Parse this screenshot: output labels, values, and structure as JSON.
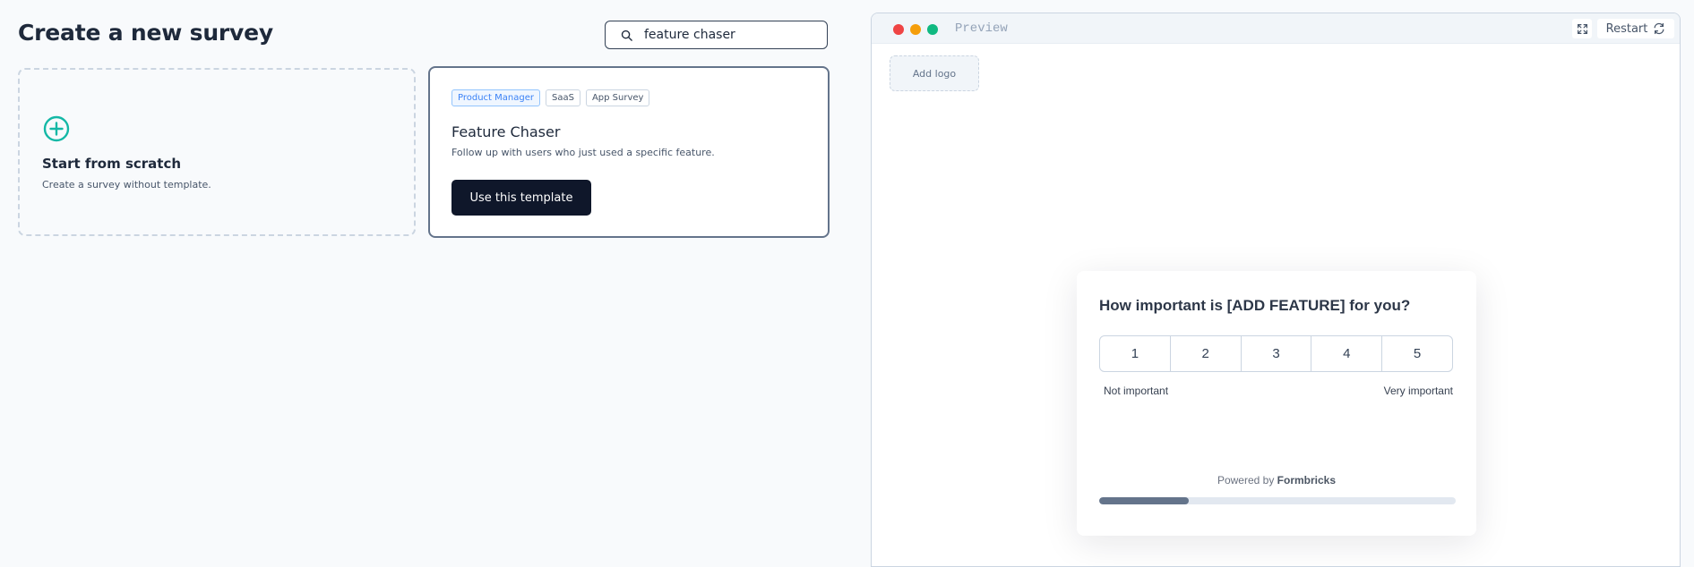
{
  "header": {
    "title": "Create a new survey"
  },
  "search": {
    "value": "feature chaser",
    "icon": "search-icon"
  },
  "scratch_card": {
    "title": "Start from scratch",
    "description": "Create a survey without template.",
    "icon": "plus-circle-icon",
    "icon_color": "#14b8a6"
  },
  "template_card": {
    "tags": [
      "Product Manager",
      "SaaS",
      "App Survey"
    ],
    "name": "Feature Chaser",
    "description": "Follow up with users who just used a specific feature.",
    "button_label": "Use this template"
  },
  "preview": {
    "label": "Preview",
    "restart_label": "Restart",
    "add_logo_label": "Add logo",
    "window_dot_colors": [
      "#ef4444",
      "#f59e0b",
      "#10b981"
    ],
    "survey": {
      "question": "How important is [ADD FEATURE] for you?",
      "scale": [
        "1",
        "2",
        "3",
        "4",
        "5"
      ],
      "lower_label": "Not important",
      "upper_label": "Very important",
      "powered_by_prefix": "Powered by",
      "powered_by_brand": "Formbricks",
      "progress_fraction": 0.25
    }
  }
}
